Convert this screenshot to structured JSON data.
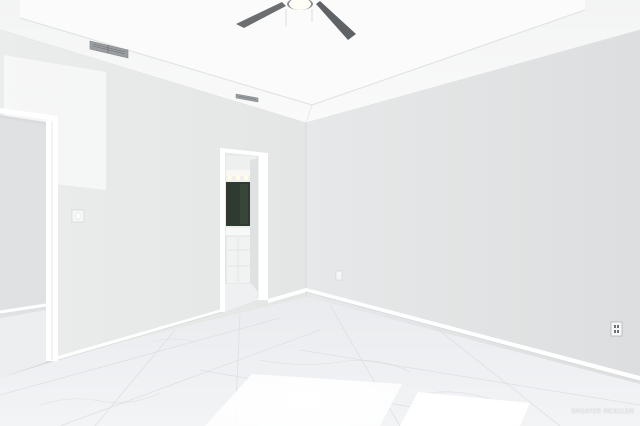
{
  "photo": {
    "watermark": "GREATER MCALLEN"
  },
  "palette": {
    "ceiling": "#f6f7f7",
    "wall_left": "#e9ebeb",
    "wall_right": "#e1e3e4",
    "floor": "#eff0f2",
    "trim": "#ffffff",
    "vent": "#8a8d90",
    "fan_blade": "#6c6f72",
    "bath_mirror": "#2f3a30"
  },
  "icons": [
    "ceiling-fan-icon",
    "air-vent-icon",
    "light-switch-icon",
    "power-outlet-icon"
  ]
}
